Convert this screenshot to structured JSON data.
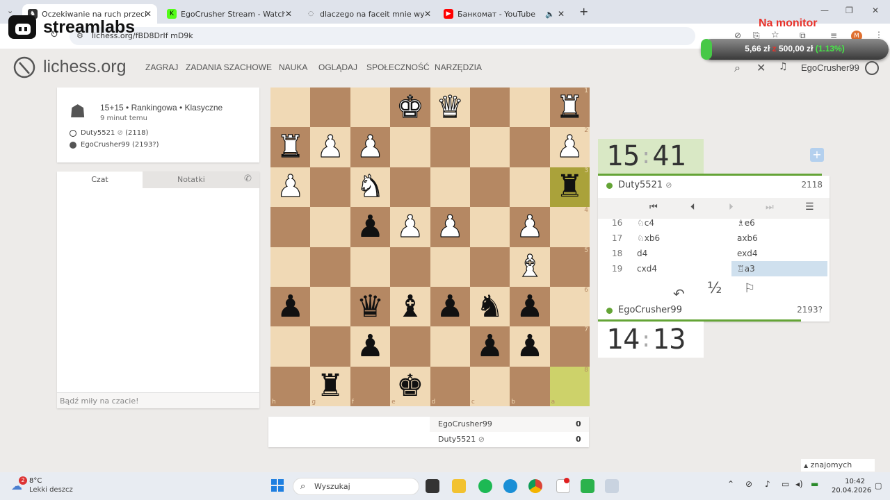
{
  "browser": {
    "tabs": [
      {
        "title": "Oczekiwanie na ruch przeciwnika",
        "active": true
      },
      {
        "title": "EgoCrusher Stream - Watch Live",
        "active": false
      },
      {
        "title": "dlaczego na faceit mnie wywala",
        "active": false
      },
      {
        "title": "Банкомат - YouTube",
        "active": false
      }
    ],
    "url": "lichess.org/fBD8DrIf mD9k"
  },
  "overlay": {
    "brand": "streamlabs",
    "monitor_label": "Na monitor",
    "donation_current": "5,66 zł",
    "donation_of": "z",
    "donation_goal": "500,00 zł",
    "donation_pct": "(1.13%)",
    "progress": 0.0113
  },
  "site": {
    "logo": "lichess.org",
    "menu": [
      "ZAGRAJ",
      "ZADANIA SZACHOWE",
      "NAUKA",
      "OGLĄDAJ",
      "SPOŁECZNOŚĆ",
      "NARZĘDZIA"
    ],
    "username": "EgoCrusher99"
  },
  "game_info": {
    "mode": "15+15 • Rankingowa • Klasyczne",
    "time_ago": "9 minut temu",
    "white_player": "Duty5521",
    "white_rating": "(2118)",
    "black_player": "EgoCrusher99",
    "black_rating": "(2193?)"
  },
  "chat": {
    "tab_chat": "Czat",
    "tab_notes": "Notatki",
    "placeholder": "Bądź miły na czacie!"
  },
  "board": {
    "ranks": [
      "1",
      "2",
      "3",
      "4",
      "5",
      "6",
      "7",
      "8"
    ],
    "files": [
      "h",
      "g",
      "f",
      "e",
      "d",
      "c",
      "b",
      "a"
    ],
    "rows": [
      [
        "",
        "",
        "",
        "wK",
        "wQ",
        "",
        "",
        "wR"
      ],
      [
        "wR",
        "wP",
        "wP",
        "",
        "",
        "",
        "",
        "wP"
      ],
      [
        "wP",
        "",
        "wN",
        "",
        "",
        "",
        "",
        "bR"
      ],
      [
        "",
        "",
        "bP",
        "wP",
        "wP",
        "",
        "wP",
        ""
      ],
      [
        "",
        "",
        "",
        "",
        "",
        "",
        "wB",
        ""
      ],
      [
        "bP",
        "",
        "bQ",
        "bB",
        "bP",
        "bN",
        "bP",
        ""
      ],
      [
        "",
        "",
        "bP",
        "",
        "",
        "bP",
        "bP",
        ""
      ],
      [
        "",
        "bR",
        "",
        "bK",
        "",
        "",
        "",
        ""
      ]
    ]
  },
  "clocks": {
    "opponent_min": "15",
    "opponent_sec": "41",
    "player_min": "14",
    "player_sec": "13"
  },
  "players": {
    "top_name": "Duty5521",
    "top_rating": "2118",
    "bottom_name": "EgoCrusher99",
    "bottom_rating": "2193?"
  },
  "moves": [
    {
      "n": "16",
      "w": "♘c4",
      "b": "♗e6"
    },
    {
      "n": "17",
      "w": "♘xb6",
      "b": "axb6"
    },
    {
      "n": "18",
      "w": "d4",
      "b": "exd4"
    },
    {
      "n": "19",
      "w": "cxd4",
      "b": "♖a3"
    }
  ],
  "actions": {
    "draw": "½"
  },
  "scores": [
    {
      "name": "EgoCrusher99",
      "score": "0"
    },
    {
      "name": "Duty5521",
      "score": "0"
    }
  ],
  "friends": "znajomych online",
  "taskbar": {
    "weather_temp": "8°C",
    "weather_desc": "Lekki deszcz",
    "weather_badge": "2",
    "search": "Wyszukaj",
    "time": "10:42",
    "date": "20.04.2026"
  }
}
